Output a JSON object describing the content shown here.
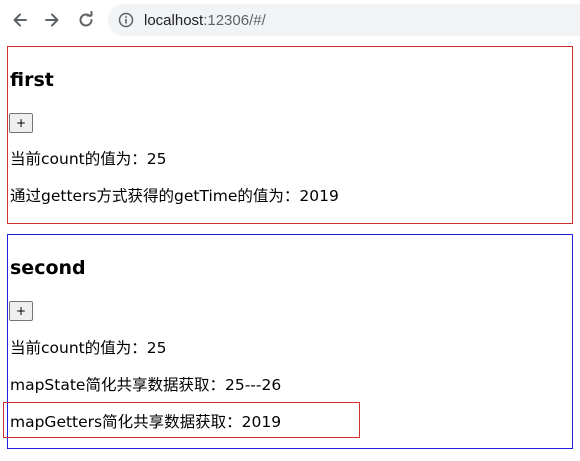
{
  "browser": {
    "url_host": "localhost",
    "url_rest": ":12306/#/"
  },
  "first": {
    "title": "first",
    "button_label": "+",
    "count_line": "当前count的值为：25",
    "getters_line": "通过getters方式获得的getTime的值为：2019"
  },
  "second": {
    "title": "second",
    "button_label": "+",
    "count_line": "当前count的值为：25",
    "mapstate_line": "mapState简化共享数据获取：25---26",
    "mapgetters_line": "mapGetters简化共享数据获取：2019"
  },
  "colors": {
    "first_border": "#d32f2f",
    "second_border": "#1f1fe0",
    "highlight_border": "#d32f2f"
  }
}
